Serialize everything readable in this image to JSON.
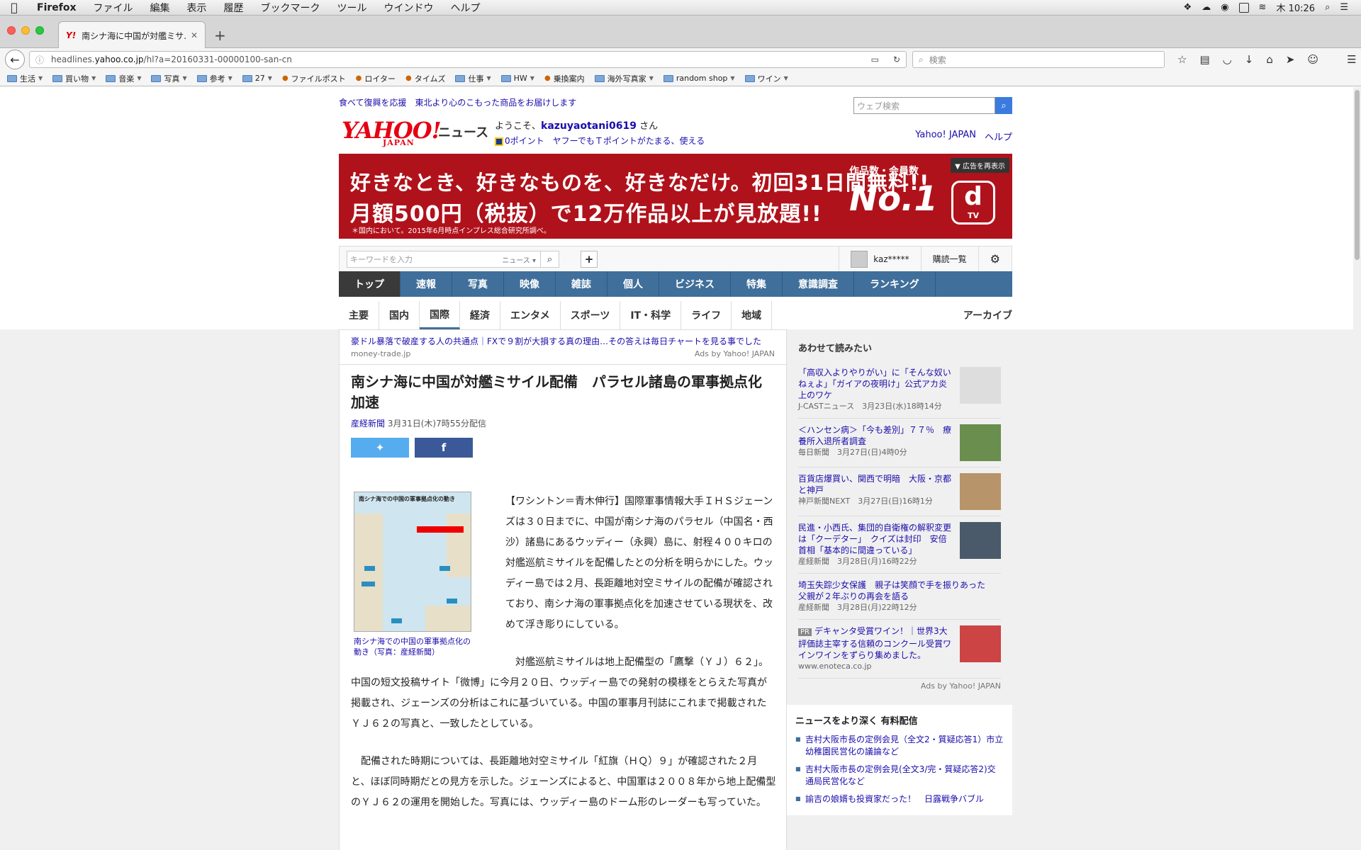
{
  "menubar": {
    "app": "Firefox",
    "items": [
      "ファイル",
      "編集",
      "表示",
      "履歴",
      "ブックマーク",
      "ツール",
      "ウインドウ",
      "ヘルプ"
    ],
    "clock": "木 10:26"
  },
  "tab": {
    "title": "南シナ海に中国が対艦ミサ…",
    "favicon": "Y!"
  },
  "navbar": {
    "url_prefix": "headlines.",
    "url_host": "yahoo.co.jp",
    "url_path": "/hl?a=20160331-00000100-san-cn",
    "search_placeholder": "検索"
  },
  "bookmarks": [
    {
      "label": "生活",
      "type": "folder"
    },
    {
      "label": "買い物",
      "type": "folder"
    },
    {
      "label": "音楽",
      "type": "folder"
    },
    {
      "label": "写真",
      "type": "folder"
    },
    {
      "label": "参考",
      "type": "folder"
    },
    {
      "label": "27",
      "type": "folder"
    },
    {
      "label": "ファイルポスト",
      "type": "site"
    },
    {
      "label": "ロイター",
      "type": "site"
    },
    {
      "label": "タイムズ",
      "type": "site"
    },
    {
      "label": "仕事",
      "type": "folder"
    },
    {
      "label": "HW",
      "type": "folder"
    },
    {
      "label": "乗換案内",
      "type": "site"
    },
    {
      "label": "海外写真家",
      "type": "folder"
    },
    {
      "label": "random shop",
      "type": "folder"
    },
    {
      "label": "ワイン",
      "type": "folder"
    }
  ],
  "page": {
    "promo": "食べて復興を応援　東北より心のこもった商品をお届けします",
    "websearch_placeholder": "ウェブ検索",
    "logo_main": "YAHOO!",
    "logo_sub": "JAPAN",
    "news_label": "ニュース",
    "welcome_prefix": "ようこそ、",
    "username": "kazuyaotani0619",
    "welcome_suffix": " さん",
    "points": "0ポイント　ヤフーでもＴポイントがたまる、使える",
    "toplinks": [
      "Yahoo! JAPAN",
      "ヘルプ"
    ]
  },
  "ad_banner": {
    "line1": "好きなとき、好きなものを、好きなだけ。初回31日間無料!!",
    "line2": "月額500円（税抜）で12万作品以上が見放題!!",
    "line3": "＊国内において。2015年6月時点インプレス総合研究所調べ。",
    "rank_caption": "作品数・会員数",
    "rank": "No.1",
    "brand_d": "d",
    "brand_tv": "TV",
    "redisplay": "広告を再表示"
  },
  "toolbar": {
    "keyword_placeholder": "キーワードを入力",
    "scope": "ニュース",
    "user": "kaz*****",
    "subscriptions": "購読一覧"
  },
  "main_nav": [
    "トップ",
    "速報",
    "写真",
    "映像",
    "雑誌",
    "個人",
    "ビジネス",
    "特集",
    "意識調査",
    "ランキング"
  ],
  "sub_nav": [
    "主要",
    "国内",
    "国際",
    "経済",
    "エンタメ",
    "スポーツ",
    "IT・科学",
    "ライフ",
    "地域"
  ],
  "sub_nav_active": "国際",
  "archive": "アーカイブ",
  "top_ad": {
    "text": "豪ドル暴落で破産する人の共通点｜FXで９割が大損する真の理由…その答えは毎日チャートを見る事でした",
    "domain": "money-trade.jp",
    "ads_by": "Ads by Yahoo! JAPAN"
  },
  "article": {
    "title": "南シナ海に中国が対艦ミサイル配備　パラセル諸島の軍事拠点化加速",
    "source": "産経新聞",
    "date": "3月31日(木)7時55分配信",
    "figure_caption": "南シナ海での中国の軍事拠点化の動き（写真：産経新聞）",
    "map_title": "南シナ海での中国の軍事拠点化の動き",
    "para1": "【ワシントン＝青木伸行】国際軍事情報大手ＩＨＳジェーンズは３０日までに、中国が南シナ海のパラセル（中国名・西沙）諸島にあるウッディー（永興）島に、射程４００キロの対艦巡航ミサイルを配備したとの分析を明らかにした。ウッディー島では２月、長距離地対空ミサイルの配備が確認されており、南シナ海の軍事拠点化を加速させている現状を、改めて浮き彫りにしている。",
    "para2": "対艦巡航ミサイルは地上配備型の「鷹撃（ＹＪ）６２」。中国の短文投稿サイト「微博」に今月２０日、ウッディー島での発射の模様をとらえた写真が掲載され、ジェーンズの分析はこれに基づいている。中国の軍事月刊誌にこれまで掲載されたＹＪ６２の写真と、一致したとしている。",
    "para3": "配備された時期については、長距離地対空ミサイル「紅旗（ＨＱ）９」が確認された２月と、ほぼ同時期だとの見方を示した。ジェーンズによると、中国軍は２００８年から地上配備型のＹＪ６２の運用を開始した。写真には、ウッディー島のドーム形のレーダーも写っていた。"
  },
  "sidebar": {
    "related_title": "あわせて読みたい",
    "related": [
      {
        "title": "「高収入よりやりがい」に「そんな奴いねぇよ」「ガイアの夜明け」公式アカ炎上のワケ",
        "meta": "J-CASTニュース　3月23日(水)18時14分"
      },
      {
        "title": "＜ハンセン病＞「今も差別」７７％　療養所入退所者調査",
        "meta": "毎日新聞　3月27日(日)4時0分"
      },
      {
        "title": "百貨店爆買い、関西で明暗　大阪・京都と神戸",
        "meta": "神戸新聞NEXT　3月27日(日)16時1分"
      },
      {
        "title": "民進・小西氏、集団的自衛権の解釈変更は「クーデター」　クイズは封印　安倍首相「基本的に間違っている」",
        "meta": "産経新聞　3月28日(月)16時22分"
      },
      {
        "title": "埼玉失踪少女保護　親子は笑顔で手を振りあった　父親が２年ぶりの再会を語る",
        "meta": "産経新聞　3月28日(月)22時12分"
      }
    ],
    "pr_label": "PR",
    "pr_title": "デキャンタ受賞ワイン！｜世界3大評価誌主宰する信頼のコンクール受賞ワインワインをずらり集めました。",
    "pr_domain": "www.enoteca.co.jp",
    "ads_by": "Ads by Yahoo! JAPAN",
    "paid_title": "ニュースをより深く 有料配信",
    "paid_items": [
      "吉村大阪市長の定例会見（全文2・質疑応答1）市立幼稚園民営化の議論など",
      "吉村大阪市長の定例会見(全文3/完・質疑応答2)交通局民営化など",
      "諭吉の娘婿も投資家だった！　日露戦争バブル"
    ]
  },
  "colors": {
    "nav_blue": "#3f6f9a",
    "yahoo_red": "#e60012",
    "ad_red": "#b0121b",
    "link_blue": "#1a0dab",
    "twitter": "#55acee",
    "facebook": "#3b5998"
  }
}
